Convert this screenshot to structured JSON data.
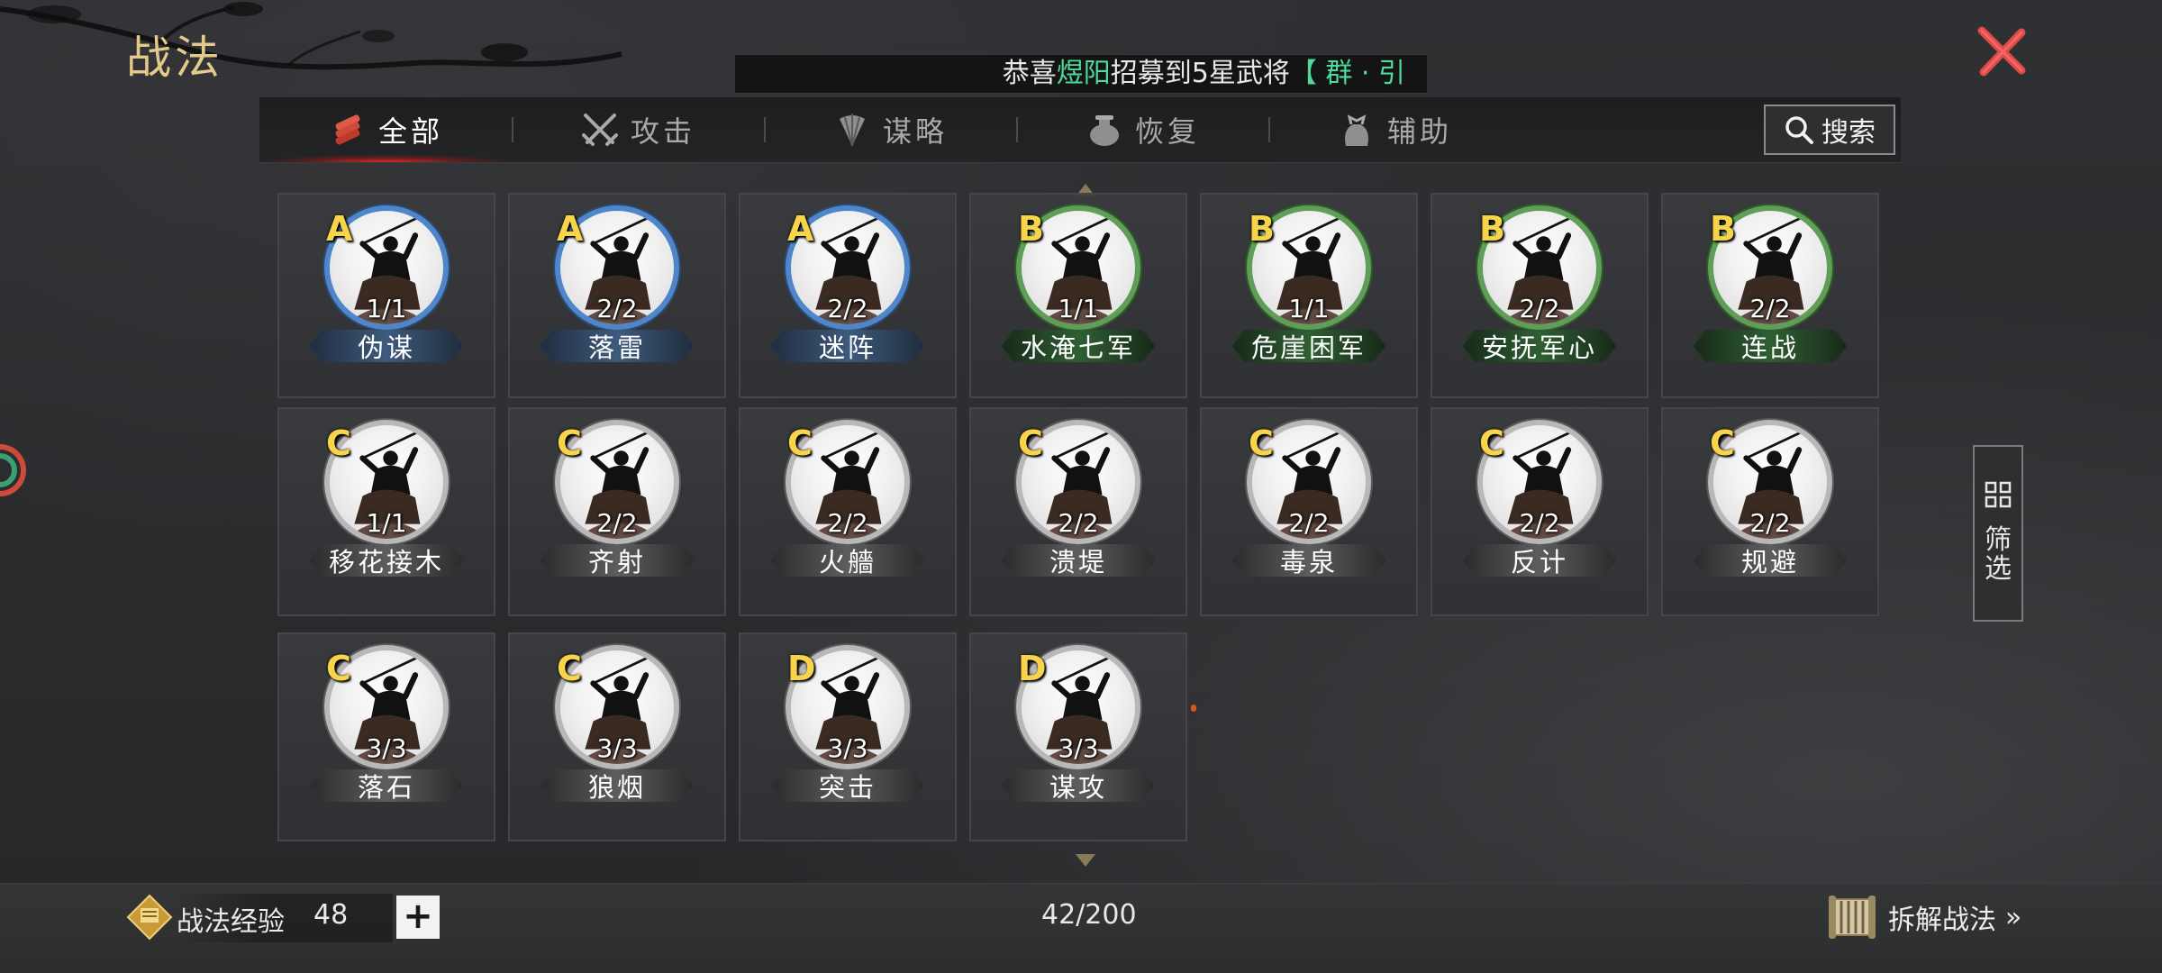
{
  "header": {
    "title": "战法",
    "ticker": {
      "prefix": "恭喜",
      "name": "煜阳",
      "middle": "招募到5星武将",
      "tail": "【 群 · 引"
    }
  },
  "tabs": [
    {
      "label": "全部",
      "icon": "scroll-bundle-icon",
      "active": true
    },
    {
      "label": "攻击",
      "icon": "crossed-swords-icon",
      "active": false
    },
    {
      "label": "谋略",
      "icon": "feather-fan-icon",
      "active": false
    },
    {
      "label": "恢复",
      "icon": "medicine-pot-icon",
      "active": false
    },
    {
      "label": "辅助",
      "icon": "pouch-icon",
      "active": false
    }
  ],
  "search": {
    "label": "搜索",
    "icon": "search-icon"
  },
  "tactics": [
    {
      "grade": "A",
      "count": "1/1",
      "name": "伪谋"
    },
    {
      "grade": "A",
      "count": "2/2",
      "name": "落雷"
    },
    {
      "grade": "A",
      "count": "2/2",
      "name": "迷阵"
    },
    {
      "grade": "B",
      "count": "1/1",
      "name": "水淹七军"
    },
    {
      "grade": "B",
      "count": "1/1",
      "name": "危崖困军"
    },
    {
      "grade": "B",
      "count": "2/2",
      "name": "安抚军心"
    },
    {
      "grade": "B",
      "count": "2/2",
      "name": "连战"
    },
    {
      "grade": "C",
      "count": "1/1",
      "name": "移花接木"
    },
    {
      "grade": "C",
      "count": "2/2",
      "name": "齐射"
    },
    {
      "grade": "C",
      "count": "2/2",
      "name": "火艢"
    },
    {
      "grade": "C",
      "count": "2/2",
      "name": "溃堤"
    },
    {
      "grade": "C",
      "count": "2/2",
      "name": "毒泉"
    },
    {
      "grade": "C",
      "count": "2/2",
      "name": "反计"
    },
    {
      "grade": "C",
      "count": "2/2",
      "name": "规避"
    },
    {
      "grade": "C",
      "count": "3/3",
      "name": "落石"
    },
    {
      "grade": "C",
      "count": "3/3",
      "name": "狼烟"
    },
    {
      "grade": "D",
      "count": "3/3",
      "name": "突击"
    },
    {
      "grade": "D",
      "count": "3/3",
      "name": "谋攻"
    }
  ],
  "filter": {
    "label_1": "筛",
    "label_2": "选",
    "icon": "grid-filter-icon"
  },
  "footer": {
    "exp_label": "战法经验",
    "exp_value": "48",
    "plus_label": "+",
    "capacity": "42/200",
    "decompose_label": "拆解战法",
    "decompose_arrow": "»"
  },
  "colors": {
    "title_gold": "#e3c98a",
    "grade_yellow": "#f7d44a",
    "ring_a": "#4f86c9",
    "ring_b": "#5f9e56",
    "ring_cd": "#b8b8b8",
    "close_red": "#e24a4a",
    "ticker_green": "#4fd99a"
  }
}
